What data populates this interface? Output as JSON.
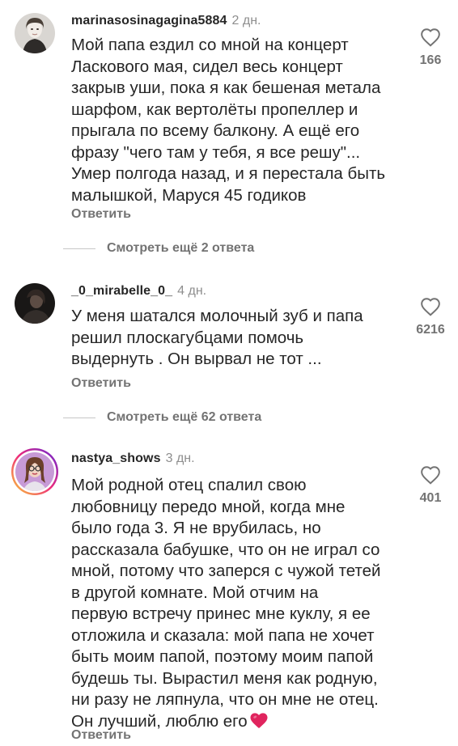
{
  "comments": [
    {
      "username": "marinasosinagagina5884",
      "time": "2 дн.",
      "text": "Мой папа ездил со мной на концерт\nЛаскового мая, сидел весь концерт\nзакрыв уши, пока я как бешеная метала\nшарфом, как вертолёты пропеллер и\nпрыгала по всему балкону. А ещё его\nфразу \"чего там у тебя, я все решу\"...\nУмер полгода назад, и я перестала быть\nмалышкой, Маруся 45 годиков",
      "reply_label": "Ответить",
      "likes": "166",
      "view_replies": "Смотреть ещё 2 ответа"
    },
    {
      "username": "_0_mirabelle_0_",
      "time": "4 дн.",
      "text": "У меня шатался молочный зуб и папа\nрешил плоскагубцами помочь\nвыдернуть . Он вырвал не тот ...",
      "reply_label": "Ответить",
      "likes": "6216",
      "view_replies": "Смотреть ещё 62 ответа"
    },
    {
      "username": "nastya_shows",
      "time": "3 дн.",
      "text": "Мой родной отец спалил свою\nлюбовницу передо мной, когда мне\nбыло года 3. Я не врубилась, но\nрассказала бабушке, что он не играл со\nмной, потому что заперся с чужой тетей\nв другой комнате. Мой отчим на\nпервую встречу принес мне куклу, я ее\nотложила и сказала: мой папа не хочет\nбыть моим папой, поэтому моим папой\nбудешь ты. Вырастил меня как родную,\nни разу не ляпнула, что он мне не отец.\nОн лучший, люблю его",
      "emoji": "red-heart-emoji",
      "reply_label": "Ответить",
      "likes": "401"
    }
  ],
  "colors": {
    "text": "#262626",
    "secondary": "#737373",
    "muted": "#8e8e8e",
    "story_ring_start": "#f9ce34",
    "story_ring_mid": "#ee2a7b",
    "story_ring_end": "#6228d7",
    "heart_emoji": "#e0245e"
  }
}
